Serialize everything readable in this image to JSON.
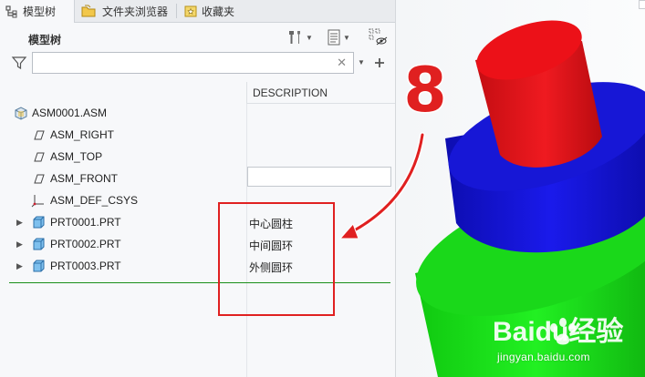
{
  "tabs": [
    {
      "label": "模型树",
      "icon": "model-tree-icon",
      "active": true
    },
    {
      "label": "文件夹浏览器",
      "icon": "folder-browser-icon",
      "active": false
    },
    {
      "label": "收藏夹",
      "icon": "favorites-icon",
      "active": false
    }
  ],
  "panel": {
    "title": "模型树",
    "search_value": "",
    "search_placeholder": ""
  },
  "columns": {
    "description": "DESCRIPTION"
  },
  "tree": [
    {
      "label": "ASM0001.ASM",
      "icon": "assembly-icon",
      "expandable": false,
      "description": ""
    },
    {
      "label": "ASM_RIGHT",
      "icon": "datum-plane-icon",
      "expandable": false,
      "description": ""
    },
    {
      "label": "ASM_TOP",
      "icon": "datum-plane-icon",
      "expandable": false,
      "description": ""
    },
    {
      "label": "ASM_FRONT",
      "icon": "datum-plane-icon",
      "expandable": false,
      "description": ""
    },
    {
      "label": "ASM_DEF_CSYS",
      "icon": "coordinate-system-icon",
      "expandable": false,
      "description": ""
    },
    {
      "label": "PRT0001.PRT",
      "icon": "part-icon",
      "expandable": true,
      "description": "中心圆柱"
    },
    {
      "label": "PRT0002.PRT",
      "icon": "part-icon",
      "expandable": true,
      "description": "中间圆环"
    },
    {
      "label": "PRT0003.PRT",
      "icon": "part-icon",
      "expandable": true,
      "description": "外侧圆环"
    }
  ],
  "annotation": {
    "step_number": "8",
    "step_color": "#e02020",
    "box_color": "#e02020"
  },
  "watermark": {
    "brand": "Baidu经验",
    "url": "jingyan.baidu.com"
  },
  "model_colors": {
    "top": "#e8131b",
    "middle": "#1414dc",
    "bottom": "#15e815"
  }
}
